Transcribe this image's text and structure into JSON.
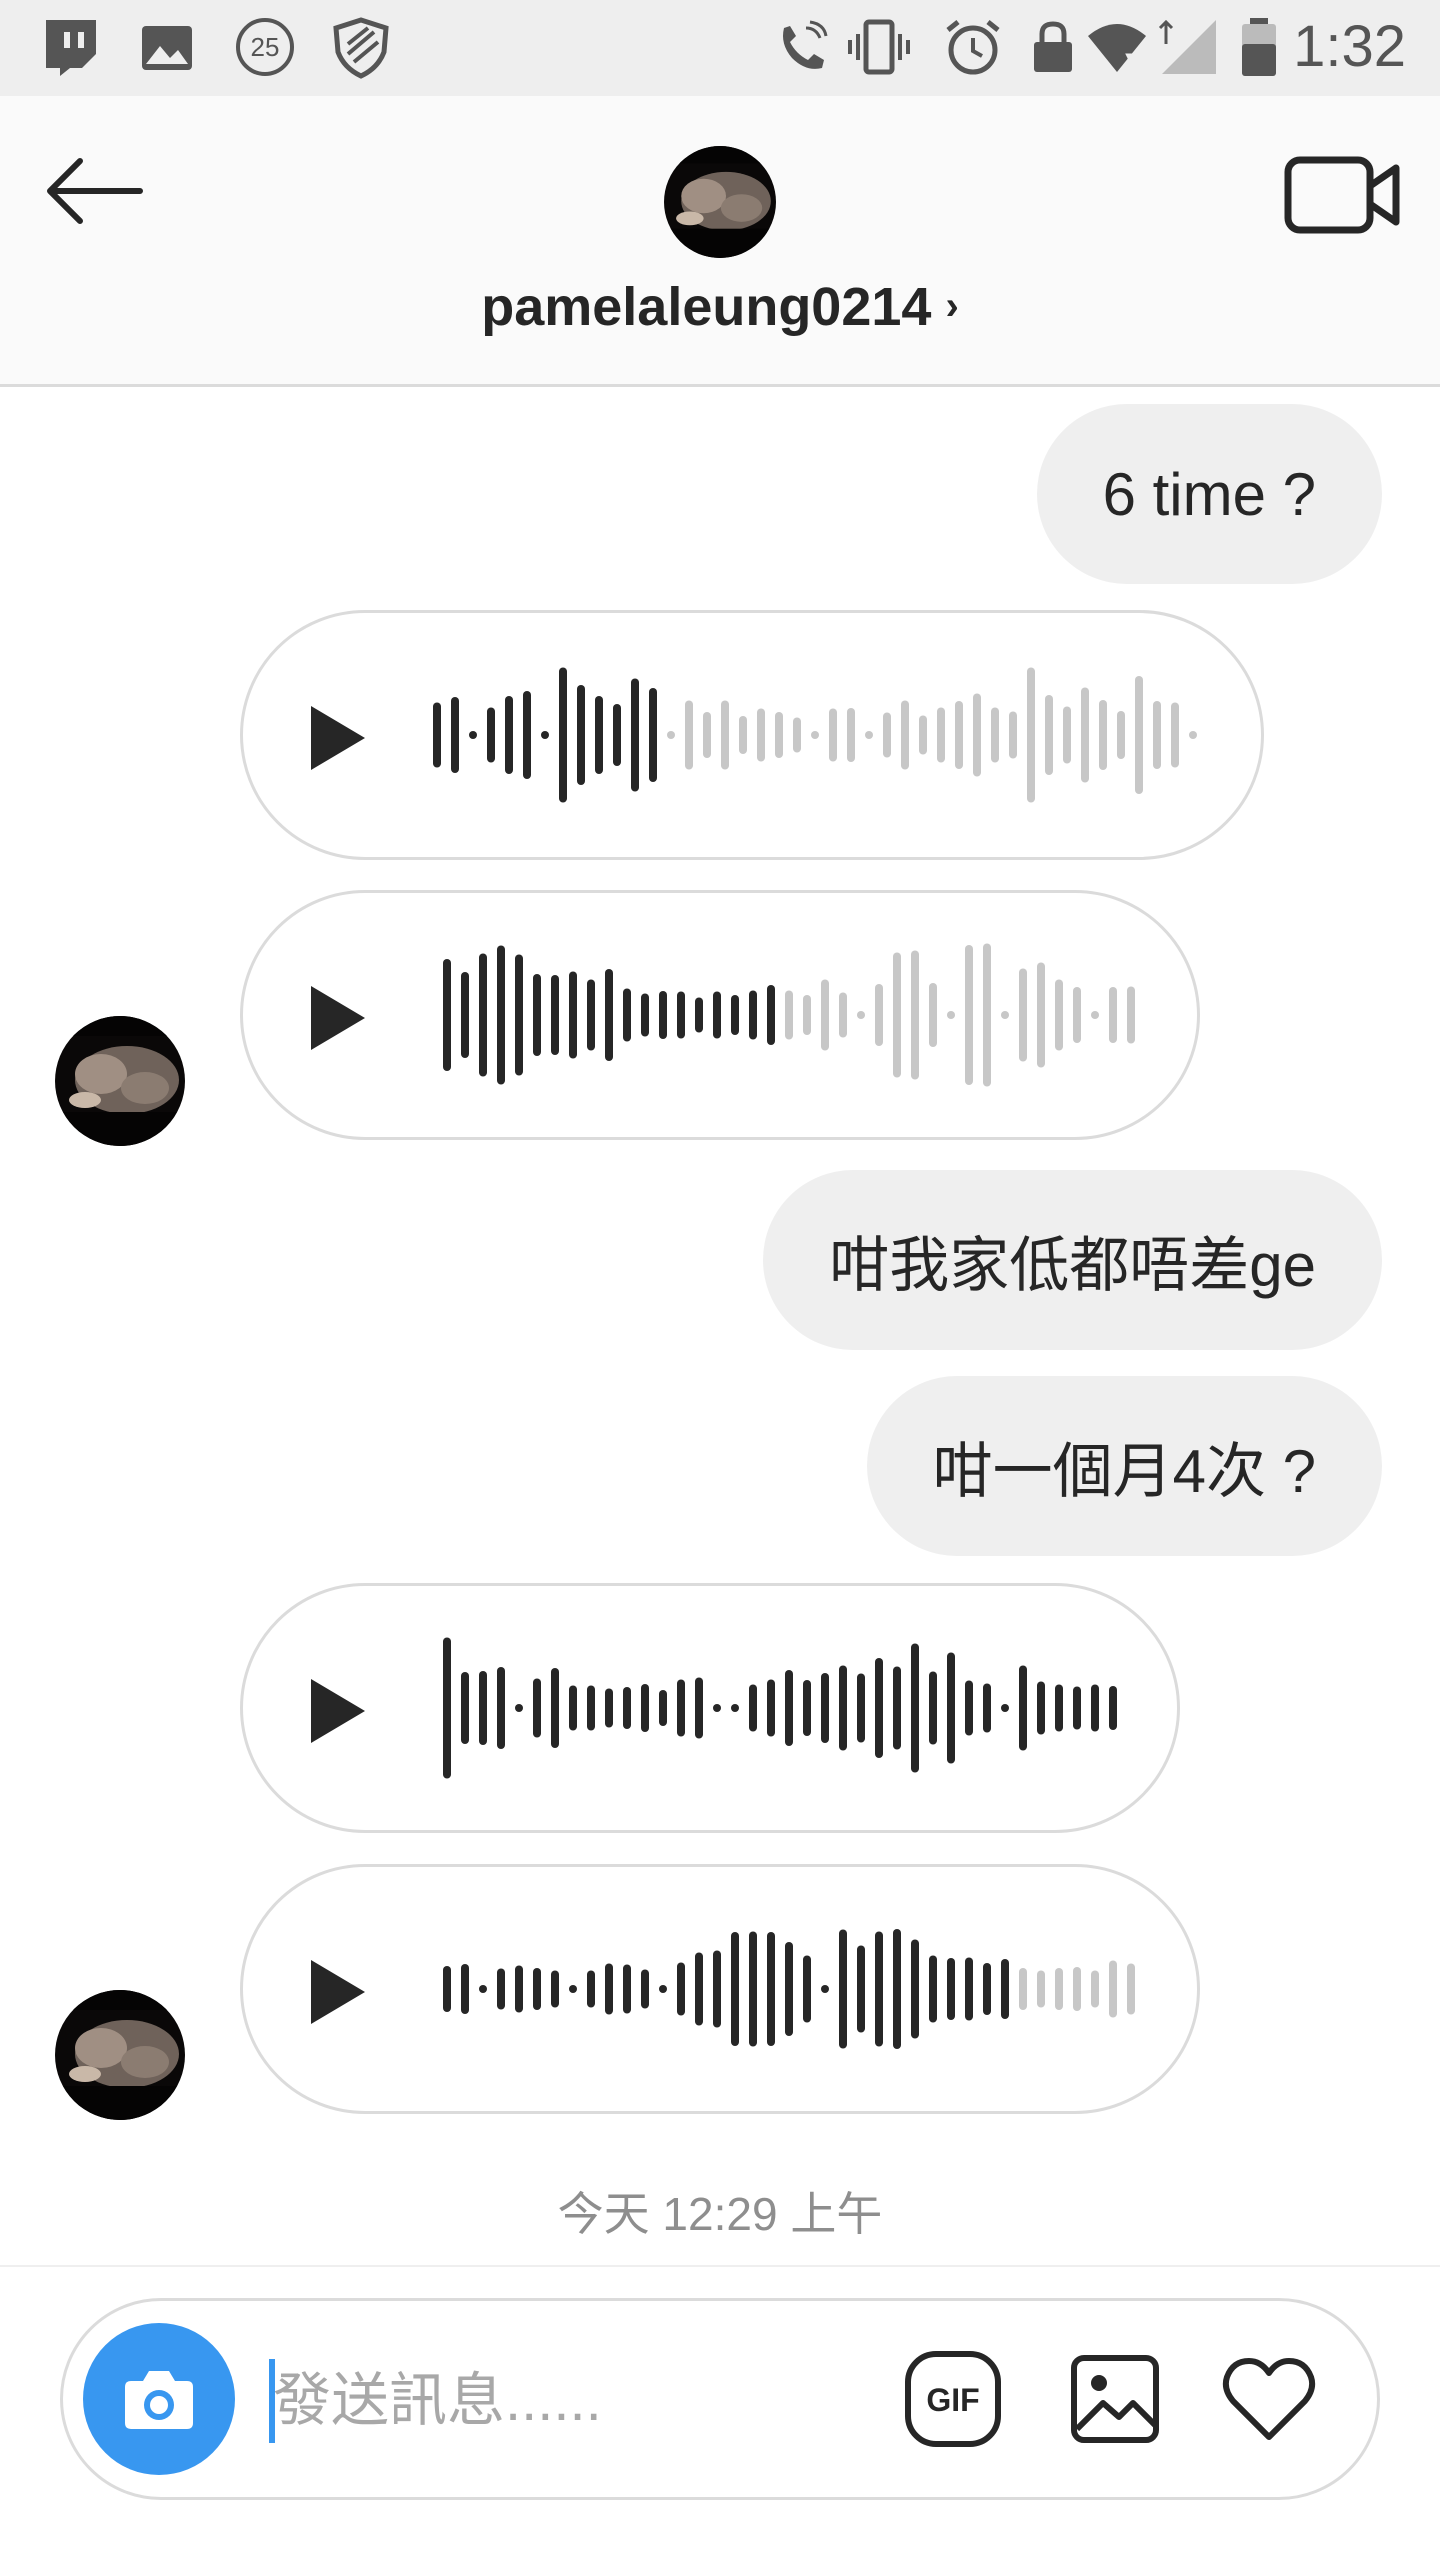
{
  "status_bar": {
    "time": "1:32",
    "left_icons": [
      "twitch-icon",
      "gallery-icon",
      "notification-count-25-icon",
      "shield-icon"
    ],
    "notification_count": "25",
    "right_icons": [
      "wifi-call-icon",
      "vibrate-icon",
      "alarm-icon",
      "lock-icon",
      "wifi-icon",
      "signal-icon",
      "battery-icon"
    ]
  },
  "header": {
    "username": "pamelaleung0214",
    "chevron": "›"
  },
  "messages": [
    {
      "type": "text",
      "side": "right",
      "text": "6 time ?"
    },
    {
      "type": "voice",
      "side": "left",
      "progress": 0.3
    },
    {
      "type": "voice",
      "side": "left",
      "progress": 0.49
    },
    {
      "type": "text",
      "side": "right",
      "text": "咁我家低都唔差ge"
    },
    {
      "type": "text",
      "side": "right",
      "text": "咁一個月4次 ?"
    },
    {
      "type": "voice",
      "side": "left",
      "progress": 1.0
    },
    {
      "type": "voice",
      "side": "left",
      "progress": 0.83
    }
  ],
  "timestamp": "今天 12:29 上午",
  "composer": {
    "placeholder": "發送訊息......",
    "gif_label": "GIF"
  },
  "colors": {
    "accent": "#3897f0",
    "bubble": "#efefef",
    "border": "#dbdbdb",
    "wave_played": "#262626",
    "wave_unplayed": "#c7c7c7"
  }
}
